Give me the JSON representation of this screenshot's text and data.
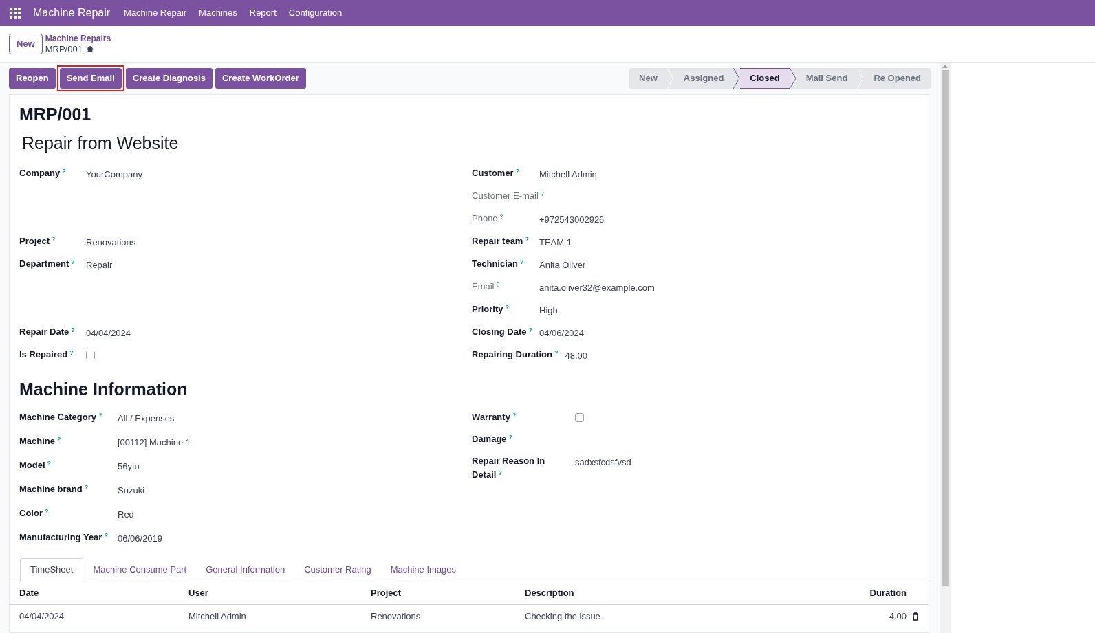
{
  "navbar": {
    "app_name": "Machine Repair",
    "menu": [
      "Machine Repair",
      "Machines",
      "Report",
      "Configuration"
    ]
  },
  "control_panel": {
    "new_button": "New",
    "breadcrumb": "Machine Repairs",
    "record": "MRP/001"
  },
  "actions": [
    {
      "label": "Reopen",
      "highlighted": false
    },
    {
      "label": "Send Email",
      "highlighted": true
    },
    {
      "label": "Create Diagnosis",
      "highlighted": false
    },
    {
      "label": "Create WorkOrder",
      "highlighted": false
    }
  ],
  "stages": [
    {
      "label": "New",
      "selected": false
    },
    {
      "label": "Assigned",
      "selected": false
    },
    {
      "label": "Closed",
      "selected": true
    },
    {
      "label": "Mail Send",
      "selected": false
    },
    {
      "label": "Re Opened",
      "selected": false
    }
  ],
  "form": {
    "reference": "MRP/001",
    "title": "Repair from Website",
    "rows": [
      {
        "left": {
          "label": "Company",
          "hint": "?",
          "muted": false,
          "kind": "text",
          "value": "YourCompany"
        },
        "right": {
          "label": "Customer",
          "hint": "?",
          "muted": false,
          "kind": "text",
          "value": "Mitchell Admin"
        }
      },
      {
        "right": {
          "label": "Customer E-mail",
          "hint": "?",
          "muted": true,
          "kind": "text"
        }
      },
      {
        "right": {
          "label": "Phone",
          "hint": "?",
          "muted": true,
          "kind": "text",
          "value": "+972543002926"
        }
      },
      {
        "left": {
          "label": "Project",
          "hint": "?",
          "muted": false,
          "kind": "text",
          "value": "Renovations"
        },
        "right": {
          "label": "Repair team",
          "hint": "?",
          "muted": false,
          "kind": "text",
          "value": "TEAM 1"
        }
      },
      {
        "left": {
          "label": "Department",
          "hint": "?",
          "muted": false,
          "kind": "text",
          "value": "Repair"
        },
        "right": {
          "label": "Technician",
          "hint": "?",
          "muted": false,
          "kind": "text",
          "value": "Anita Oliver"
        }
      },
      {
        "right": {
          "label": "Email",
          "hint": "?",
          "muted": true,
          "kind": "text",
          "value": "anita.oliver32@example.com"
        }
      },
      {
        "right": {
          "label": "Priority",
          "hint": "?",
          "muted": false,
          "kind": "text",
          "value": "High"
        }
      },
      {
        "left": {
          "label": "Repair Date",
          "hint": "?",
          "muted": false,
          "kind": "text",
          "value": "04/04/2024"
        },
        "right": {
          "label": "Closing Date",
          "hint": "?",
          "muted": false,
          "kind": "text",
          "value": "04/06/2024"
        }
      },
      {
        "left": {
          "label": "Is Repaired",
          "hint": "?",
          "muted": false,
          "kind": "checkbox",
          "checked": false
        },
        "right": {
          "label": "Repairing Duration",
          "hint": "?",
          "muted": false,
          "kind": "text",
          "value": "48.00"
        }
      }
    ],
    "machine_section": {
      "heading": "Machine Information",
      "left": [
        {
          "label": "Machine Category",
          "hint": "?",
          "muted": false,
          "kind": "text",
          "value": "All / Expenses"
        },
        {
          "label": "Machine",
          "hint": "?",
          "muted": false,
          "kind": "text",
          "value": "[00112] Machine 1"
        },
        {
          "label": "Model",
          "hint": "?",
          "muted": false,
          "kind": "text",
          "value": "56ytu"
        },
        {
          "label": "Machine brand",
          "hint": "?",
          "muted": false,
          "kind": "text",
          "value": "Suzuki"
        },
        {
          "label": "Color",
          "hint": "?",
          "muted": false,
          "kind": "text",
          "value": "Red"
        },
        {
          "label": "Manufacturing Year",
          "hint": "?",
          "muted": false,
          "kind": "text",
          "value": "06/06/2019"
        }
      ],
      "right": [
        {
          "label": "Warranty",
          "hint": "?",
          "muted": false,
          "kind": "checkbox",
          "checked": false
        },
        {
          "label": "Damage",
          "hint": "?",
          "muted": false,
          "kind": "text"
        },
        {
          "label": "Repair Reason In Detail",
          "hint": "?",
          "muted": false,
          "kind": "text",
          "value": "sadxsfcdsfvsd"
        }
      ]
    },
    "tabs": [
      {
        "label": "TimeSheet",
        "selected": true
      },
      {
        "label": "Machine Consume Part",
        "selected": false
      },
      {
        "label": "General Information",
        "selected": false
      },
      {
        "label": "Customer Rating",
        "selected": false
      },
      {
        "label": "Machine Images",
        "selected": false
      }
    ],
    "table": {
      "columns": [
        "Date",
        "User",
        "Project",
        "Description",
        "Duration"
      ],
      "rows": [
        {
          "cells": [
            "04/04/2024",
            "Mitchell Admin",
            "Renovations",
            "Checking the issue.",
            "4.00"
          ]
        }
      ]
    }
  }
}
